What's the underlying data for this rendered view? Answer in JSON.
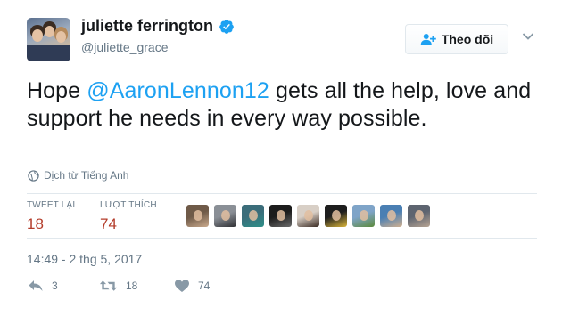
{
  "user": {
    "display_name": "juliette ferrington",
    "handle": "@juliette_grace"
  },
  "follow_button": {
    "label": "Theo dõi"
  },
  "tweet": {
    "text_before": "Hope ",
    "mention": "@AaronLennon12",
    "text_after": " gets all the help, love and support he needs in every way possible."
  },
  "translate_label": "Dịch từ Tiếng Anh",
  "stats": {
    "retweets_label": "TWEET LẠI",
    "retweets_value": "18",
    "likes_label": "LƯỢT THÍCH",
    "likes_value": "74"
  },
  "likers": [
    {
      "name": "liker-1",
      "colors": [
        "#6f5a48",
        "#c9a98c"
      ]
    },
    {
      "name": "liker-2",
      "colors": [
        "#8a8f96",
        "#2e2f33"
      ]
    },
    {
      "name": "liker-3",
      "colors": [
        "#3b6d7a",
        "#2e8f88"
      ]
    },
    {
      "name": "liker-4",
      "colors": [
        "#1c1c1c",
        "#6a6a6a"
      ]
    },
    {
      "name": "liker-5",
      "colors": [
        "#d8cfc6",
        "#3a2a22"
      ]
    },
    {
      "name": "liker-6",
      "colors": [
        "#1e1e1e",
        "#d9b43a"
      ]
    },
    {
      "name": "liker-7",
      "colors": [
        "#7fa4c8",
        "#5c8a3b"
      ]
    },
    {
      "name": "liker-8",
      "colors": [
        "#4a7fb3",
        "#d0b090"
      ]
    },
    {
      "name": "liker-9",
      "colors": [
        "#5d6470",
        "#b7a493"
      ]
    }
  ],
  "timestamp": "14:49 - 2 thg 5, 2017",
  "actions": {
    "reply_count": "3",
    "retweet_count": "18",
    "like_count": "74"
  },
  "colors": {
    "mention": "#1da1f2",
    "stat_value": "#b33b29",
    "verified": "#1da1f2",
    "secondary_text": "#657786"
  }
}
